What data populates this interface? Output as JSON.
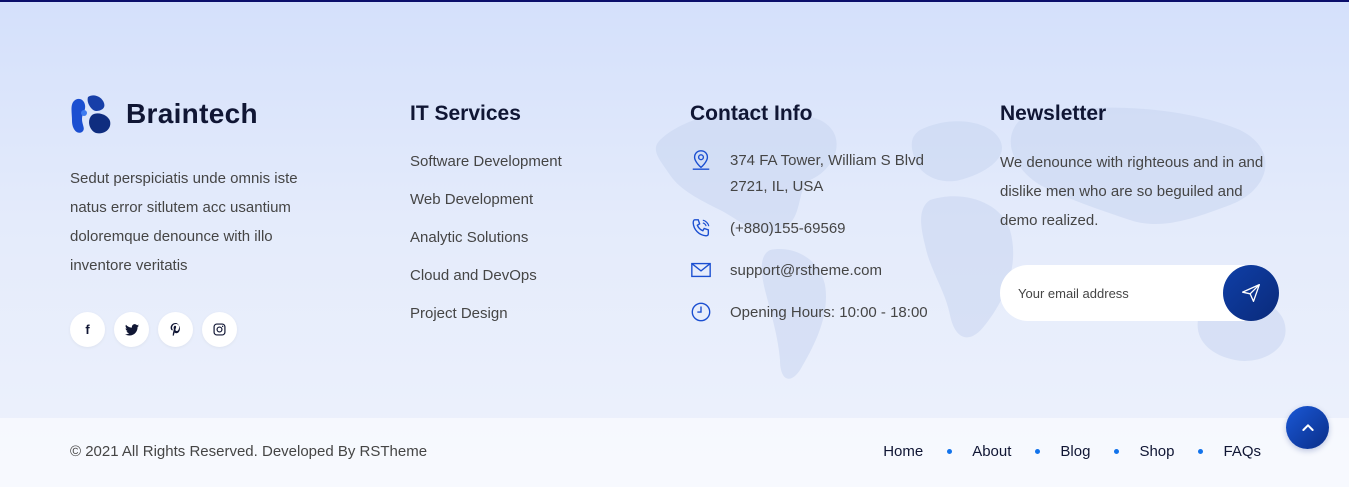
{
  "brand": {
    "name": "Braintech"
  },
  "about": {
    "text": "Sedut perspiciatis unde omnis iste natus error sitlutem acc usantium doloremque denounce with illo inventore veritatis"
  },
  "socials": [
    {
      "icon": "facebook-icon",
      "glyph": "f"
    },
    {
      "icon": "twitter-icon"
    },
    {
      "icon": "pinterest-icon"
    },
    {
      "icon": "instagram-icon"
    }
  ],
  "services": {
    "title": "IT Services",
    "items": [
      "Software Development",
      "Web Development",
      "Analytic Solutions",
      "Cloud and DevOps",
      "Project Design"
    ]
  },
  "contact": {
    "title": "Contact Info",
    "address_line1": "374 FA Tower, William S Blvd",
    "address_line2": "2721, IL, USA",
    "phone": "(+880)155-69569",
    "email": "support@rstheme.com",
    "hours": "Opening Hours: 10:00 - 18:00"
  },
  "newsletter": {
    "title": "Newsletter",
    "text": "We denounce with righteous and in and dislike men who are so beguiled and demo realized.",
    "placeholder": "Your email address"
  },
  "footer": {
    "copyright": "© 2021 All Rights Reserved. Developed By RSTheme",
    "nav": [
      "Home",
      "About",
      "Blog",
      "Shop",
      "FAQs"
    ]
  },
  "colors": {
    "dark": "#101634",
    "accent": "#1273eb",
    "button": "#0f3fa7"
  }
}
